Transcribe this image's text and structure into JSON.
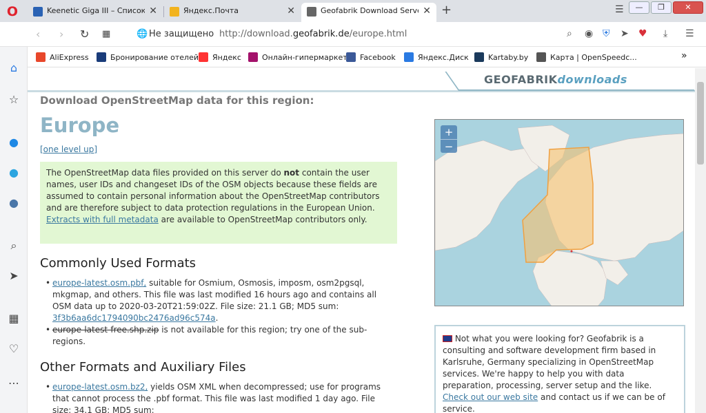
{
  "tabs": [
    {
      "label": "Keenetic Giga III – Список ус",
      "fav_color": "#2a62b4"
    },
    {
      "label": "Яндекс.Почта",
      "fav_color": "#f2b31e"
    },
    {
      "label": "Geofabrik Download Server",
      "fav_color": "#666666"
    }
  ],
  "address": {
    "security": "Не защищено",
    "url_prefix": "http://download.",
    "url_domain": "geofabrik.de",
    "url_path": "/europe.html"
  },
  "bookmarks": [
    {
      "label": "AliExpress",
      "color": "#e8472b"
    },
    {
      "label": "Бронирование отелей",
      "color": "#1a3c7a"
    },
    {
      "label": "Яндекс",
      "color": "#ff3333"
    },
    {
      "label": "Онлайн-гипермаркет",
      "color": "#a4126b"
    },
    {
      "label": "Facebook",
      "color": "#3b5998"
    },
    {
      "label": "Яндекс.Диск",
      "color": "#2a7ae2"
    },
    {
      "label": "Kartaby.by",
      "color": "#1b3a5c"
    },
    {
      "label": "Карта | OpenSpeedc...",
      "color": "#555555"
    }
  ],
  "page": {
    "brand_main": "GEOFABRIK",
    "brand_sub": "downloads",
    "subheading": "Download OpenStreetMap data for this region:",
    "title": "Europe",
    "up_link": "[one level up]",
    "note_text_1": "The OpenStreetMap data files provided on this server do ",
    "note_bold": "not",
    "note_text_2": " contain the user names, user IDs and changeset IDs of the OSM objects because these fields are assumed to contain personal information about the OpenStreetMap contributors and are therefore subject to data protection regulations in the European Union.",
    "note_link": "Extracts with full metadata",
    "note_text_3": " are available to OpenStreetMap contributors only.",
    "common_heading": "Commonly Used Formats",
    "pbf_link": "europe-latest.osm.pbf,",
    "pbf_text": " suitable for Osmium, Osmosis, imposm, osm2pgsql, mkgmap, and others. This file was last modified 16 hours ago and contains all OSM data up to 2020-03-20T21:59:02Z. File size: 21.1 GB; MD5 sum: ",
    "pbf_md5": "3f3b6aa6dc1794090bc2476ad96c574a",
    "pbf_end": ".",
    "shp_strike": "europe-latest-free.shp.zip",
    "shp_text": " is not available for this region; try one of the sub-regions.",
    "other_heading": "Other Formats and Auxiliary Files",
    "bz2_link": "europe-latest.osm.bz2,",
    "bz2_text": " yields OSM XML when decompressed; use for programs that cannot process the .pbf format. This file was last modified 1 day ago. File size: 34.1 GB; MD5 sum:",
    "info_text_1": " Not what you were looking for? Geofabrik is a consulting and software development firm based in Karlsruhe, Germany specializing in OpenStreetMap services. We're happy to help you with data preparation, processing, server setup and the like. ",
    "info_link": "Check out our web site",
    "info_text_2": " and contact us if we can be of service."
  },
  "map": {
    "zoom_in": "+",
    "zoom_out": "−",
    "sea": "#aad3df",
    "land": "#f2efe9",
    "region_fill": "#f5c16f",
    "region_stroke": "#f0a040"
  },
  "colors": {
    "accent_link": "#3a78a0",
    "note_bg": "#e2f7d3",
    "title": "#8fb5c6"
  }
}
